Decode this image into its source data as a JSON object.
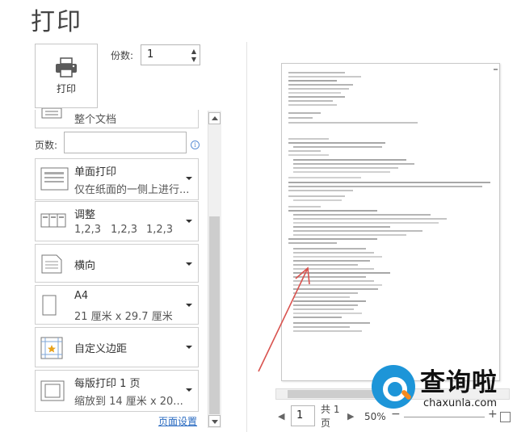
{
  "title": "打印",
  "print_button": {
    "label": "打印",
    "icon": "printer-icon"
  },
  "copies": {
    "label": "份数:",
    "value": "1"
  },
  "settings": {
    "print_range": {
      "label": "整个文档"
    },
    "pages": {
      "label": "页数:",
      "value": ""
    },
    "sides": {
      "title": "单面打印",
      "subtitle": "仅在纸面的一侧上进行..."
    },
    "collate": {
      "title": "调整",
      "groups": [
        "1,2,3",
        "1,2,3",
        "1,2,3"
      ]
    },
    "orientation": {
      "title": "横向"
    },
    "paper": {
      "title": "A4",
      "subtitle": "21 厘米 x 29.7 厘米"
    },
    "margins": {
      "title": "自定义边距"
    },
    "pages_per_sheet": {
      "title": "每版打印 1 页",
      "subtitle": "缩放到 14 厘米 x 20..."
    }
  },
  "page_setup_link": "页面设置",
  "preview_nav": {
    "current_page": "1",
    "total_text": "共 1 页",
    "zoom": "50%",
    "minus": "−",
    "plus": "+"
  },
  "watermark": {
    "cn": "查询啦",
    "en": "chaxunla.com"
  },
  "colors": {
    "link": "#2a6bc1",
    "annotation": "#d9534f",
    "watermark_blue": "#1d95d8",
    "watermark_orange": "#f58a1f"
  }
}
